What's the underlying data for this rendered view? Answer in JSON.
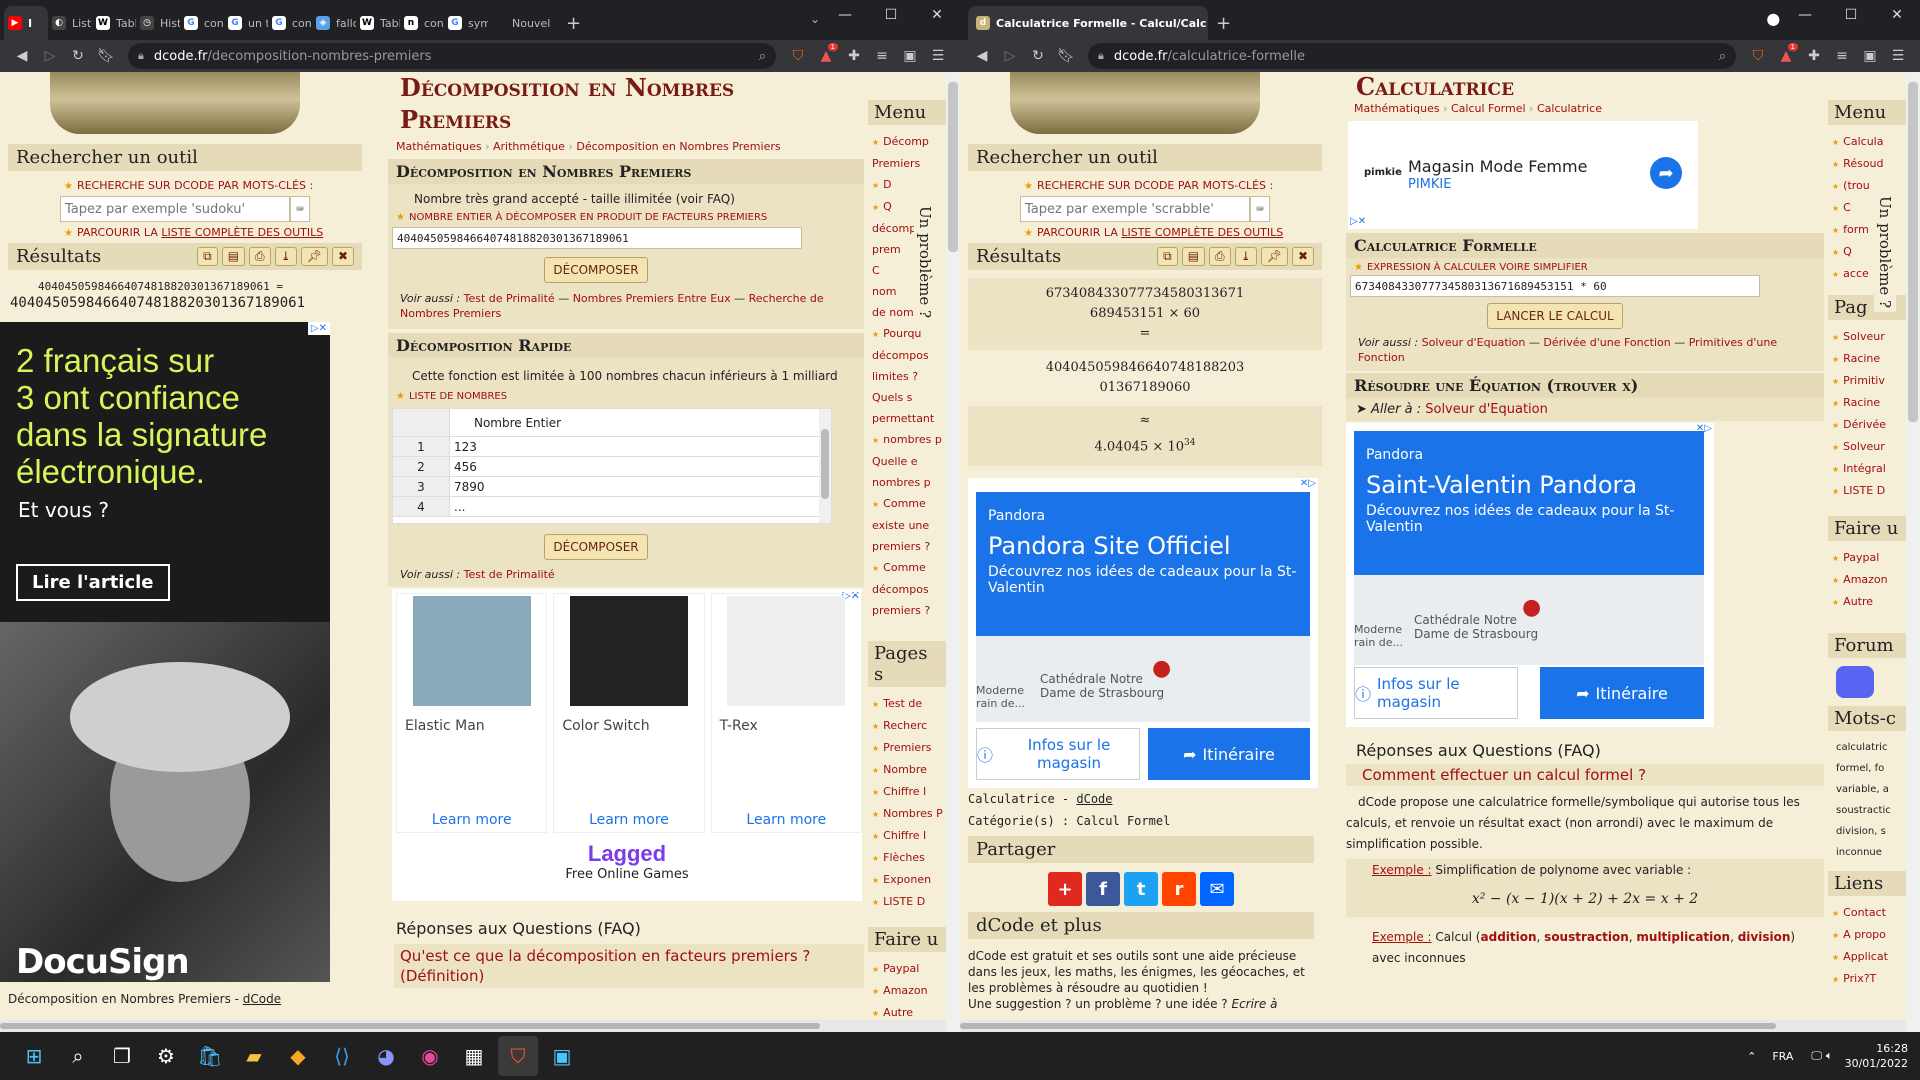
{
  "left": {
    "tabs": [
      {
        "label": "I",
        "fav": "yt"
      },
      {
        "label": "Liste",
        "fav": "g"
      },
      {
        "label": "Tabl",
        "fav": "w"
      },
      {
        "label": "Hist",
        "fav": "h"
      },
      {
        "label": "conv",
        "fav": "G"
      },
      {
        "label": "un t",
        "fav": "G"
      },
      {
        "label": "conv",
        "fav": "G"
      },
      {
        "label": "fallo",
        "fav": "f"
      },
      {
        "label": "Tabl",
        "fav": "w"
      },
      {
        "label": "conv",
        "fav": "n"
      },
      {
        "label": "sym",
        "fav": "G"
      },
      {
        "label": "Nouvel",
        "fav": ""
      }
    ],
    "url_host": "dcode.fr",
    "url_path": "/decomposition-nombres-premiers",
    "ext_badge": "1",
    "sidebar": {
      "search_title": "Rechercher un outil",
      "search_caption": "RECHERCHE SUR DCODE PAR MOTS-CLÉS :",
      "search_placeholder": "Tapez par exemple 'sudoku'",
      "list_caption_a": "PARCOURIR LA ",
      "list_caption_b": "LISTE COMPLÈTE DES OUTILS",
      "results_title": "Résultats",
      "result_line1": "40404505984664074818820301367189061 =",
      "result_line2": "40404505984664074818820301367189061",
      "footer_a": "Décomposition en Nombres Premiers - ",
      "footer_b": "dCode"
    },
    "ad_docusign": {
      "headline_l1": "2 français sur",
      "headline_l2": "3 ont confiance",
      "headline_l3": "dans la signature",
      "headline_l4": "électronique.",
      "sub": "Et vous ?",
      "cta": "Lire l'article",
      "brand": "DocuSign"
    },
    "main": {
      "title_l1": "Décomposition en Nombres",
      "title_l2": "Premiers",
      "crumbs": [
        "Mathématiques",
        "Arithmétique",
        "Décomposition en Nombres Premiers"
      ],
      "sec1_title": "Décomposition en Nombres Premiers",
      "sec1_note": "Nombre très grand accepté - taille illimitée (voir FAQ)",
      "sec1_label": "NOMBRE ENTIER À DÉCOMPOSER EN PRODUIT DE FACTEURS PREMIERS",
      "sec1_value": "40404505984664074818820301367189061",
      "btn_decompose": "DÉCOMPOSER",
      "voir_label": "Voir aussi : ",
      "voir_links": [
        "Test de Primalité",
        "Nombres Premiers Entre Eux",
        "Recherche de Nombres Premiers"
      ],
      "sec2_title": "Décomposition Rapide",
      "sec2_note": "Cette fonction est limitée à 100 nombres chacun inférieurs à 1 milliard",
      "sec2_label": "LISTE DE NOMBRES",
      "table_header": "Nombre Entier",
      "table_rows": [
        [
          "1",
          "123"
        ],
        [
          "2",
          "456"
        ],
        [
          "3",
          "7890"
        ],
        [
          "4",
          "..."
        ]
      ],
      "btn_decompose2": "DÉCOMPOSER",
      "voir2_link": "Test de Primalité",
      "games": [
        {
          "name": "Elastic Man",
          "cta": "Learn more"
        },
        {
          "name": "Color Switch",
          "cta": "Learn more"
        },
        {
          "name": "T-Rex",
          "cta": "Learn more"
        }
      ],
      "games_brand": "Lagged",
      "games_tag": "Free Online Games",
      "faq_title": "Réponses aux Questions (FAQ)",
      "faq_q1": "Qu'est ce que la décomposition en facteurs premiers ? (Définition)"
    },
    "menu": {
      "menu_title": "Menu",
      "menu_items": [
        "Décomp",
        "Premiers",
        "D",
        "Q",
        "décomp",
        "prem",
        "C",
        "nom",
        "de nombre",
        "Pourqu",
        "décompos",
        "limites ?",
        "Quels s",
        "permettant",
        "nombres p",
        "Quelle e",
        "nombres p",
        "Comme",
        "existe une",
        "premiers ?",
        "Comme",
        "décompos",
        "premiers ?"
      ],
      "side_vertical": "Un problème ?",
      "pages_title": "Pages s",
      "pages_items": [
        "Test de",
        "Recherc",
        "Premiers",
        "Nombre",
        "Chiffre I",
        "Nombres P",
        "Chiffre I",
        "Flèches",
        "Exponen",
        "LISTE D"
      ],
      "faire_title": "Faire u",
      "faire_items": [
        "Paypal",
        "Amazon",
        "Autre"
      ]
    }
  },
  "right": {
    "tab_title": "Calculatrice Formelle - Calcul/Calc",
    "url_host": "dcode.fr",
    "url_path": "/calculatrice-formelle",
    "ext_badge": "1",
    "sidebar": {
      "search_title": "Rechercher un outil",
      "search_caption": "RECHERCHE SUR DCODE PAR MOTS-CLÉS :",
      "search_placeholder": "Tapez par exemple 'scrabble'",
      "list_caption_a": "PARCOURIR LA ",
      "list_caption_b": "LISTE COMPLÈTE DES OUTILS",
      "results_title": "Résultats",
      "res_a1": "67340843307773458031367​1",
      "res_a2": "689453151 × 60",
      "res_eq": "=",
      "res_b1": "404045059846640748188203",
      "res_b2": "01367189060",
      "res_approx": "≈",
      "res_c": "4.04045 × 10",
      "res_c_exp": "34",
      "footer_name": "Calculatrice - ",
      "footer_link": "dCode",
      "footer_cat": "Catégorie(s) : Calcul Formel",
      "share_title": "Partager",
      "plus_title": "dCode et plus",
      "plus_text": "dCode est gratuit et ses outils sont une aide précieuse dans les jeux, les maths, les énigmes, les géocaches, et les problèmes à résoudre au quotidien !",
      "plus_text2a": "Une suggestion ? un problème ? une idée ? ",
      "plus_text2b": "Ecrire à"
    },
    "ad_pandora1": {
      "brand": "Pandora",
      "title": "Pandora Site Officiel",
      "desc": "Découvrez nos idées de cadeaux pour la St-Valentin",
      "map_label": "Cathédrale Notre Dame de Strasbourg",
      "map_label2": "Moderne rain de...",
      "btn_info": "Infos sur le magasin",
      "btn_route": "Itinéraire"
    },
    "main": {
      "title": "Calculatrice",
      "crumbs": [
        "Mathématiques",
        "Calcul Formel",
        "Calculatrice"
      ],
      "ad_pimkie_title": "Magasin Mode Femme",
      "ad_pimkie_brand": "PIMKIE",
      "ad_pimkie_logo": "pimkie",
      "sec1_title": "Calculatrice Formelle",
      "sec1_label": "EXPRESSION À CALCULER VOIRE SIMPLIFIER",
      "sec1_value": "673408433077734580313671689453151 * 60",
      "btn_launch": "LANCER LE CALCUL",
      "voir_label": "Voir aussi : ",
      "voir_links": [
        "Solveur d'Equation",
        "Dérivée d'une Fonction",
        "Primitives d'une Fonction"
      ],
      "sec2_title": "Résoudre une Équation (trouver x)",
      "aller_label": "Aller à : ",
      "aller_link": "Solveur d'Equation",
      "faq_title": "Réponses aux Questions (FAQ)",
      "faq_q1": "Comment effectuer un calcul formel ?",
      "faq_text": "dCode propose une calculatrice formelle/symbolique qui autorise tous les calculs, et renvoie un résultat exact (non arrondi) avec le maximum de simplification possible.",
      "ex1_label": "Exemple :",
      "ex1_text": " Simplification de polynome avec variable :",
      "ex1_formula": "x² − (x − 1)(x + 2) + 2x = x + 2",
      "ex2_label": "Exemple :",
      "ex2_text": " Calcul (",
      "ex2_links": [
        "addition",
        "soustraction",
        "multiplication",
        "division"
      ],
      "ex2_end": ") avec inconnues"
    },
    "ad_pandora2": {
      "brand": "Pandora",
      "title": "Saint-Valentin Pandora",
      "desc": "Découvrez nos idées de cadeaux pour la St-Valentin",
      "map_label": "Cathédrale Notre Dame de Strasbourg",
      "map_label2": "Moderne rain de...",
      "btn_info": "Infos sur le magasin",
      "btn_route": "Itinéraire"
    },
    "menu": {
      "menu_title": "Menu",
      "menu_items": [
        "Calcula",
        "Résoud",
        "(trou",
        "C",
        "form",
        "Q",
        "acce"
      ],
      "side_vertical": "Un problème ?",
      "pag_title": "Pag",
      "pag_items": [
        "Solveur",
        "Racine",
        "Primitiv",
        "Racine",
        "Dérivée",
        "Solveur",
        "Intégral",
        "LISTE D"
      ],
      "faire_title": "Faire u",
      "faire_items": [
        "Paypal",
        "Amazon",
        "Autre"
      ],
      "forum_title": "Forum",
      "mots_title": "Mots-c",
      "mots_items": [
        "calculatric",
        "formel, fo",
        "variable, a",
        "soustractic",
        "division, s",
        "inconnue"
      ],
      "liens_title": "Liens",
      "liens_items": [
        "Contact",
        "A propo",
        "Applicat",
        "Prix?T"
      ]
    }
  },
  "taskbar": {
    "lang": "FRA",
    "time": "16:28",
    "date": "30/01/2022"
  },
  "colors": {
    "dcode_bg": "#f6efd8",
    "dcode_red": "#a01010",
    "pandora_blue": "#1a73e8",
    "docusign_lime": "#d5f55a"
  }
}
